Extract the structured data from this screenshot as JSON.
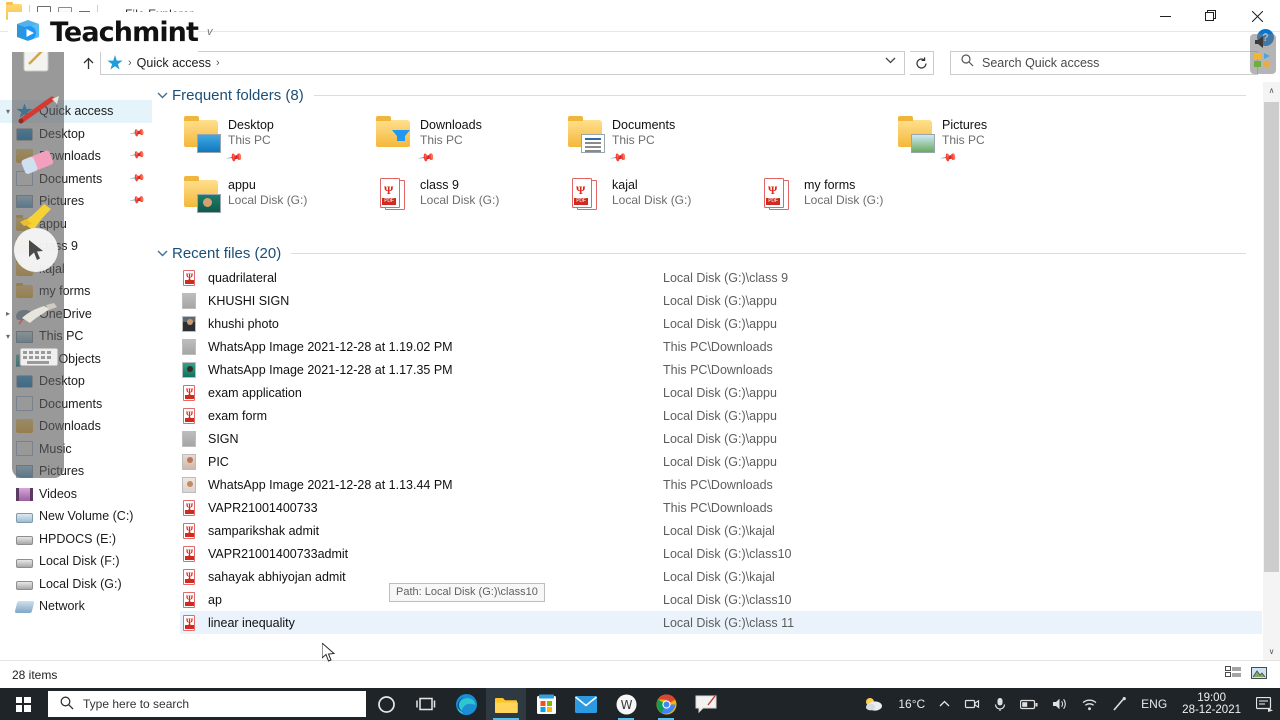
{
  "window": {
    "title": "File Explorer",
    "quick_access_toolbar": [
      "folder-icon",
      "properties-icon",
      "new-folder-icon",
      "minimize-ribbon-icon"
    ],
    "controls": {
      "minimize": "minimize-icon",
      "restore": "restore-icon",
      "close": "close-icon"
    },
    "help_label": "?",
    "ribbon_chevron": "chevron-down-icon"
  },
  "addressbar": {
    "up_label": "up-arrow-icon",
    "crumb_icon": "quick-access-star-icon",
    "crumb_text": "Quick access",
    "crumb_sep": "›",
    "dropdown": "chevron-down-icon",
    "refresh": "refresh-icon",
    "search_placeholder": "Search Quick access"
  },
  "navpane": {
    "items": [
      {
        "label": "Quick access",
        "icon": "quick-access-star-icon",
        "chevron": "▾",
        "selected": true,
        "pinned": false
      },
      {
        "label": "Desktop",
        "icon": "desktop-icon",
        "chevron": "",
        "selected": false,
        "pinned": true
      },
      {
        "label": "Downloads",
        "icon": "downloads-folder-icon",
        "chevron": "",
        "selected": false,
        "pinned": true
      },
      {
        "label": "Documents",
        "icon": "documents-icon",
        "chevron": "",
        "selected": false,
        "pinned": true
      },
      {
        "label": "Pictures",
        "icon": "pictures-icon",
        "chevron": "",
        "selected": false,
        "pinned": true
      },
      {
        "label": "appu",
        "icon": "folder-icon",
        "chevron": "",
        "selected": false,
        "pinned": false
      },
      {
        "label": "class 9",
        "icon": "folder-icon",
        "chevron": "",
        "selected": false,
        "pinned": false
      },
      {
        "label": "kajal",
        "icon": "folder-icon",
        "chevron": "",
        "selected": false,
        "pinned": false
      },
      {
        "label": "my forms",
        "icon": "folder-icon",
        "chevron": "",
        "selected": false,
        "pinned": false
      },
      {
        "label": "OneDrive",
        "icon": "onedrive-icon",
        "chevron": "▸",
        "selected": false,
        "pinned": false
      },
      {
        "label": "This PC",
        "icon": "this-pc-icon",
        "chevron": "▾",
        "selected": false,
        "pinned": false
      },
      {
        "label": "3D Objects",
        "icon": "3d-objects-icon",
        "chevron": "",
        "selected": false,
        "pinned": false
      },
      {
        "label": "Desktop",
        "icon": "desktop-icon",
        "chevron": "",
        "selected": false,
        "pinned": false
      },
      {
        "label": "Documents",
        "icon": "documents-icon",
        "chevron": "",
        "selected": false,
        "pinned": false
      },
      {
        "label": "Downloads",
        "icon": "downloads-folder-icon",
        "chevron": "",
        "selected": false,
        "pinned": false
      },
      {
        "label": "Music",
        "icon": "music-icon",
        "chevron": "",
        "selected": false,
        "pinned": false
      },
      {
        "label": "Pictures",
        "icon": "pictures-icon",
        "chevron": "",
        "selected": false,
        "pinned": false
      },
      {
        "label": "Videos",
        "icon": "videos-icon",
        "chevron": "",
        "selected": false,
        "pinned": false
      },
      {
        "label": "New Volume (C:)",
        "icon": "drive-c-icon",
        "chevron": "",
        "selected": false,
        "pinned": false
      },
      {
        "label": "HPDOCS (E:)",
        "icon": "drive-icon",
        "chevron": "",
        "selected": false,
        "pinned": false
      },
      {
        "label": "Local Disk (F:)",
        "icon": "drive-icon",
        "chevron": "",
        "selected": false,
        "pinned": false
      },
      {
        "label": "Local Disk (G:)",
        "icon": "drive-icon",
        "chevron": "",
        "selected": false,
        "pinned": false
      },
      {
        "label": "Network",
        "icon": "network-icon",
        "chevron": "",
        "selected": false,
        "pinned": false
      }
    ]
  },
  "frequent_folders": {
    "header": "Frequent folders (8)",
    "chevron": "⌄",
    "items": [
      {
        "name": "Desktop",
        "sub": "This PC",
        "icon": "desktop-folder-icon",
        "pinned": true
      },
      {
        "name": "Downloads",
        "sub": "This PC",
        "icon": "downloads-folder-icon",
        "pinned": true
      },
      {
        "name": "Documents",
        "sub": "This PC",
        "icon": "documents-folder-icon",
        "pinned": true
      },
      {
        "name": "Pictures",
        "sub": "This PC",
        "icon": "pictures-folder-icon",
        "pinned": true
      },
      {
        "name": "appu",
        "sub": "Local Disk (G:)",
        "icon": "photo-folder-icon",
        "pinned": false
      },
      {
        "name": "class 9",
        "sub": "Local Disk (G:)",
        "icon": "pdf-folder-icon",
        "pinned": false
      },
      {
        "name": "kajal",
        "sub": "Local Disk (G:)",
        "icon": "pdf-folder-icon",
        "pinned": false
      },
      {
        "name": "my forms",
        "sub": "Local Disk (G:)",
        "icon": "pdf-folder-icon",
        "pinned": false
      }
    ]
  },
  "recent_files": {
    "header": "Recent files (20)",
    "chevron": "⌄",
    "items": [
      {
        "name": "quadrilateral",
        "path": "Local Disk (G:)\\class 9",
        "icon": "pdf-icon",
        "selected": false
      },
      {
        "name": "KHUSHI SIGN",
        "path": "Local Disk (G:)\\appu",
        "icon": "image-gray-icon",
        "selected": false
      },
      {
        "name": "khushi photo",
        "path": "Local Disk (G:)\\appu",
        "icon": "image-person-icon",
        "selected": false
      },
      {
        "name": "WhatsApp Image 2021-12-28 at 1.19.02 PM",
        "path": "This PC\\Downloads",
        "icon": "image-gray-icon",
        "selected": false
      },
      {
        "name": "WhatsApp Image 2021-12-28 at 1.17.35 PM",
        "path": "This PC\\Downloads",
        "icon": "image-teal-icon",
        "selected": false
      },
      {
        "name": "exam application",
        "path": "Local Disk (G:)\\appu",
        "icon": "pdf-icon",
        "selected": false
      },
      {
        "name": "exam form",
        "path": "Local Disk (G:)\\appu",
        "icon": "pdf-icon",
        "selected": false
      },
      {
        "name": "SIGN",
        "path": "Local Disk (G:)\\appu",
        "icon": "image-gray-icon",
        "selected": false
      },
      {
        "name": "PIC",
        "path": "Local Disk (G:)\\appu",
        "icon": "image-pinkish-icon",
        "selected": false
      },
      {
        "name": "WhatsApp Image 2021-12-28 at 1.13.44 PM",
        "path": "This PC\\Downloads",
        "icon": "image-pale-icon",
        "selected": false
      },
      {
        "name": "VAPR21001400733",
        "path": "This PC\\Downloads",
        "icon": "pdf-icon",
        "selected": false
      },
      {
        "name": "samparikshak admit",
        "path": "Local Disk (G:)\\kajal",
        "icon": "pdf-icon",
        "selected": false
      },
      {
        "name": "VAPR21001400733admit",
        "path": "Local Disk (G:)\\class10",
        "icon": "pdf-icon",
        "selected": false
      },
      {
        "name": "sahayak abhiyojan admit",
        "path": "Local Disk (G:)\\kajal",
        "icon": "pdf-icon",
        "selected": false
      },
      {
        "name": "ap",
        "path": "Local Disk (G:)\\class10",
        "icon": "pdf-icon",
        "selected": false
      },
      {
        "name": "linear inequality",
        "path": "Local Disk (G:)\\class  11",
        "icon": "pdf-icon",
        "selected": true
      }
    ]
  },
  "tooltip": {
    "text": "Path: Local Disk (G:)\\class10"
  },
  "statusbar": {
    "item_count": "28 items",
    "view_buttons": [
      "details-view-icon",
      "large-icons-view-icon"
    ]
  },
  "scrollbar": {
    "up": "∧",
    "down": "∨"
  },
  "taskbar": {
    "start_label": "start-icon",
    "search_placeholder": "Type here to search",
    "pinned": [
      "cortana-icon",
      "task-view-icon",
      "microsoft-edge-icon",
      "file-explorer-icon",
      "microsoft-store-icon",
      "mail-icon",
      "w-app-icon",
      "google-chrome-icon",
      "whiteboard-icon"
    ],
    "tray": {
      "weather_icon": "partly-cloudy-icon",
      "temperature": "16°C",
      "overflow": "∧",
      "icons": [
        "camera-icon",
        "microphone-icon",
        "battery-icon",
        "volume-icon",
        "wifi-icon",
        "pen-icon"
      ],
      "language": "ENG",
      "time": "19:00",
      "date": "28-12-2021",
      "action_center": "action-center-icon"
    }
  },
  "overlays": {
    "teachmint": {
      "text": "Teachmint",
      "tail": "ᴠ",
      "mark": "teachmint-logo-icon"
    },
    "annotation_toolbar": {
      "tools": [
        "note-icon",
        "pen-red-icon",
        "eraser-icon",
        "highlighter-icon",
        "cursor-icon",
        "brush-icon",
        "keyboard-icon"
      ]
    },
    "tray_float": {
      "icons": [
        "speaker-icon",
        "apps-icon"
      ]
    }
  }
}
